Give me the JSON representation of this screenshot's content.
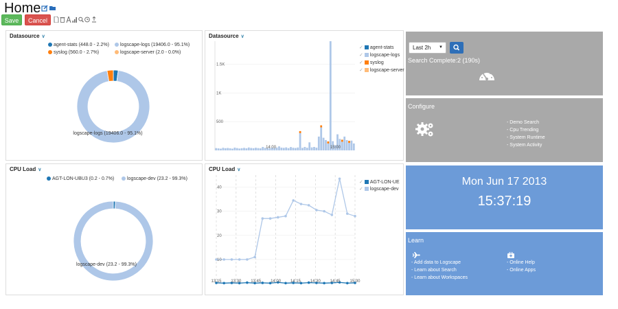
{
  "header": {
    "title": "Home",
    "save_label": "Save",
    "cancel_label": "Cancel",
    "toolbar_icons": [
      "edit-icon",
      "folder-icon",
      "file-icon",
      "trash-icon",
      "font-icon",
      "bar-chart-icon",
      "search-icon",
      "clock-icon",
      "upload-icon"
    ]
  },
  "panels": {
    "ds_pie": {
      "title": "Datasource",
      "legend": [
        "agent-stats (448.0 - 2.2%)",
        "logscape-logs (19406.0 - 95.1%)",
        "syslog (560.0 - 2.7%)",
        "logscape-server (2.0 - 0.0%)"
      ],
      "slice_label": "logscape-logs (19406.0 - 95.1%)"
    },
    "ds_bar": {
      "title": "Datasource",
      "legend": [
        "agent-stats",
        "logscape-logs",
        "syslog",
        "logscape-server"
      ]
    },
    "cpu_pie": {
      "title": "CPU Load",
      "legend": [
        "AGT-LON-UBU3 (0.2 - 0.7%)",
        "logscape-dev (23.2 - 99.3%)"
      ],
      "slice_label": "logscape-dev (23.2 - 99.3%)"
    },
    "cpu_line": {
      "title": "CPU Load",
      "legend": [
        "AGT-LON-UE",
        "logscape-dev"
      ]
    }
  },
  "chart_data": [
    {
      "type": "pie",
      "title": "Datasource",
      "categories": [
        "agent-stats",
        "logscape-logs",
        "syslog",
        "logscape-server"
      ],
      "values": [
        448.0,
        19406.0,
        560.0,
        2.0
      ],
      "colors": [
        "#1f77b4",
        "#aec7e8",
        "#ff7f0e",
        "#ffbb78"
      ]
    },
    {
      "type": "bar",
      "title": "Datasource",
      "series": [
        {
          "name": "agent-stats",
          "color": "#1f77b4"
        },
        {
          "name": "logscape-logs",
          "color": "#aec7e8"
        },
        {
          "name": "syslog",
          "color": "#ff7f0e"
        },
        {
          "name": "logscape-server",
          "color": "#ffbb78"
        }
      ],
      "yticks": [
        "500",
        "1K",
        "1.5K"
      ],
      "xticks": [
        "14:00",
        "15:00"
      ],
      "ylim": [
        0,
        1900
      ],
      "values": [
        40,
        35,
        30,
        45,
        38,
        42,
        36,
        30,
        48,
        40,
        32,
        38,
        44,
        36,
        50,
        42,
        38,
        46,
        40,
        36,
        60,
        44,
        40,
        38,
        46,
        42,
        50,
        70,
        48,
        44,
        52,
        40,
        58,
        46,
        42,
        50,
        300,
        44,
        60,
        46,
        140,
        52,
        60,
        48,
        240,
        400,
        220,
        180,
        120,
        1900,
        160,
        90,
        280,
        200,
        150,
        240,
        180,
        130,
        170,
        120
      ],
      "syslog_values": [
        0,
        0,
        0,
        0,
        0,
        0,
        0,
        0,
        0,
        0,
        0,
        0,
        0,
        0,
        0,
        0,
        0,
        0,
        0,
        0,
        0,
        0,
        0,
        0,
        0,
        0,
        0,
        0,
        0,
        0,
        0,
        0,
        0,
        0,
        0,
        0,
        0,
        0,
        0,
        0,
        0,
        0,
        0,
        0,
        0,
        0,
        0,
        0,
        0,
        0,
        0,
        0,
        0,
        0,
        0,
        0,
        0,
        0,
        0,
        0
      ]
    },
    {
      "type": "pie",
      "title": "CPU Load",
      "categories": [
        "AGT-LON-UBU3",
        "logscape-dev"
      ],
      "values": [
        0.2,
        23.2
      ],
      "colors": [
        "#1f77b4",
        "#aec7e8"
      ]
    },
    {
      "type": "line",
      "title": "CPU Load",
      "x": [
        "13:15",
        "13:30",
        "13:45",
        "14:00",
        "14:15",
        "14:30",
        "14:45",
        "15:00"
      ],
      "yticks": [
        "10",
        "20",
        "30",
        "40"
      ],
      "ylim": [
        0,
        45
      ],
      "series": [
        {
          "name": "logscape-dev",
          "color": "#aec7e8",
          "values": [
            10,
            10,
            10,
            10,
            10,
            11,
            27,
            27,
            27.5,
            28,
            34.5,
            33,
            32.5,
            30.5,
            30,
            28.5,
            43.5,
            29,
            28
          ]
        },
        {
          "name": "AGT-LON-UE",
          "color": "#1f77b4",
          "values": [
            0.3,
            0.2,
            0.3,
            0.2,
            0.4,
            0.2,
            0.3,
            0.2,
            0.5,
            0.2,
            0.3,
            0.2,
            0.4,
            0.3,
            0.2,
            0.3,
            0.5,
            0.2,
            0.3
          ]
        }
      ]
    }
  ],
  "tiles": {
    "search": {
      "select_value": "Last 2h",
      "status": "Search Complete:2 (190s)",
      "icon": "dashboard-gauge-icon"
    },
    "configure": {
      "title": "Configure",
      "icon": "cogs-icon",
      "links": [
        "- Demo Search",
        "- Cpu Trending",
        "- System Runtime",
        "- System Activity"
      ]
    },
    "clock": {
      "date": "Mon Jun 17 2013",
      "time": "15:37:19"
    },
    "learn": {
      "title": "Learn",
      "left_icon": "plane-icon",
      "right_icon": "medkit-icon",
      "left_links": [
        "- Add data to Logscape",
        "- Learn about Search",
        "- Learn about Workspaces"
      ],
      "right_links": [
        "- Online Help",
        "- Online Apps"
      ]
    }
  },
  "colors": {
    "tile_gray": "#a9a9a9",
    "tile_blue": "#6c9bd8",
    "save_green": "#5cb85c",
    "cancel_red": "#d9534f"
  }
}
